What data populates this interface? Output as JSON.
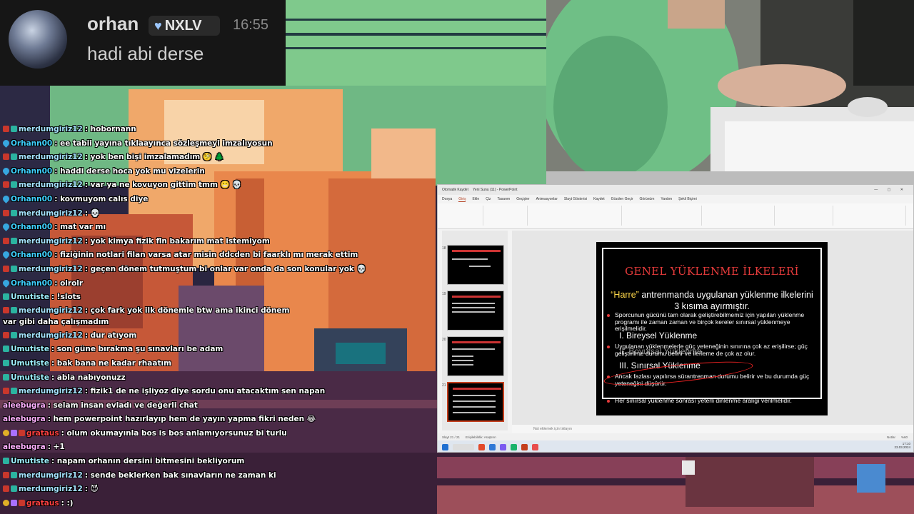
{
  "highlight": {
    "username": "orhan",
    "badge_text": "NXLV",
    "time": "16:55",
    "message": "hadi abi derse"
  },
  "chat": [
    {
      "badges": [
        "mod",
        "gift"
      ],
      "user": "merdumgiriz12",
      "color": "#a6e3ff",
      "text": ": hobornann"
    },
    {
      "badges": [
        "drop"
      ],
      "user": "Orhann00",
      "color": "#3fd0ff",
      "text": ": ee tabii yayına tıklaayınca sözleşmeyi imzalıyosun"
    },
    {
      "badges": [
        "mod",
        "gift"
      ],
      "user": "merdumgiriz12",
      "color": "#a6e3ff",
      "text": ": yok ben bişi imzalamadım 🧐 🌲"
    },
    {
      "badges": [
        "drop"
      ],
      "user": "Orhann00",
      "color": "#3fd0ff",
      "text": ": haddi derse hoca yok mu vizelerin"
    },
    {
      "badges": [
        "mod",
        "gift"
      ],
      "user": "merdumgiriz12",
      "color": "#a6e3ff",
      "text": ": var ya ne kovuyon gittim tmm 😬 💀"
    },
    {
      "badges": [
        "drop"
      ],
      "user": "Orhann00",
      "color": "#3fd0ff",
      "text": ": kovmuyom calıs diye"
    },
    {
      "badges": [
        "mod",
        "gift"
      ],
      "user": "merdumgiriz12",
      "color": "#a6e3ff",
      "text": ": 💀"
    },
    {
      "badges": [
        "drop"
      ],
      "user": "Orhann00",
      "color": "#3fd0ff",
      "text": ": mat var mı"
    },
    {
      "badges": [
        "mod",
        "gift"
      ],
      "user": "merdumgiriz12",
      "color": "#a6e3ff",
      "text": ": yok kimya fizik fln bakarım mat istemiyom"
    },
    {
      "badges": [
        "drop"
      ],
      "user": "Orhann00",
      "color": "#3fd0ff",
      "text": ": fiziğinin notlari filan varsa atar misin ddcden bi faarklı mı merak ettim"
    },
    {
      "badges": [
        "mod",
        "gift"
      ],
      "user": "merdumgiriz12",
      "color": "#a6e3ff",
      "text": ": geçen dönem tutmuştum bi onlar var onda da son konular yok 💀"
    },
    {
      "badges": [
        "drop"
      ],
      "user": "Orhann00",
      "color": "#3fd0ff",
      "text": ": olrolr"
    },
    {
      "badges": [
        "gift"
      ],
      "user": "Umutiste",
      "color": "#9ef0ff",
      "text": ": !slots"
    },
    {
      "badges": [
        "mod",
        "gift"
      ],
      "user": "merdumgiriz12",
      "color": "#a6e3ff",
      "text": ": çok fark yok ilk dönemle btw ama ikinci dönem var gibi daha çalışmadım",
      "wrap": true
    },
    {
      "badges": [
        "mod",
        "gift"
      ],
      "user": "merdumgiriz12",
      "color": "#a6e3ff",
      "text": ": dur atıyom"
    },
    {
      "badges": [
        "gift"
      ],
      "user": "Umutiste",
      "color": "#9ef0ff",
      "text": ": son güne bırakma şu sınavları be adam"
    },
    {
      "badges": [
        "gift"
      ],
      "user": "Umutiste",
      "color": "#9ef0ff",
      "text": ": bak bana ne kadar rhaatım"
    },
    {
      "badges": [
        "gift"
      ],
      "user": "Umutiste",
      "color": "#9ef0ff",
      "text": ": abla nabıyonuzz"
    },
    {
      "badges": [
        "mod",
        "gift"
      ],
      "user": "merdumgiriz12",
      "color": "#a6e3ff",
      "text": ": fizik1 de ne işliyoz diye sordu onu atacaktım sen napan"
    },
    {
      "badges": [],
      "user": "aleebugra",
      "color": "#ffb0ff",
      "text": ": selam insan evladı ve değerli chat"
    },
    {
      "badges": [],
      "user": "aleebugra",
      "color": "#ffb0ff",
      "text": ": hem powerpoint hazırlayıp hem de yayın yapma fikri neden 😂"
    },
    {
      "badges": [
        "sub",
        "prime",
        "mod"
      ],
      "user": "grataus",
      "color": "#ff4040",
      "text": ": olum okumayınla bos is bos anlamıyorsunuz bi turlu"
    },
    {
      "badges": [],
      "user": "aleebugra",
      "color": "#ffb0ff",
      "text": ": +1"
    },
    {
      "badges": [
        "gift"
      ],
      "user": "Umutiste",
      "color": "#9ef0ff",
      "text": ": napam orhanın dersini bitmesini bekliyorum"
    },
    {
      "badges": [
        "mod",
        "gift"
      ],
      "user": "merdumgiriz12",
      "color": "#a6e3ff",
      "text": ": sende beklerken bak sınavların ne zaman ki"
    },
    {
      "badges": [
        "mod",
        "gift"
      ],
      "user": "merdumgiriz12",
      "color": "#a6e3ff",
      "text": ": 😈"
    },
    {
      "badges": [
        "sub",
        "prime",
        "mod"
      ],
      "user": "grataus",
      "color": "#ff4040",
      "text": ": :)"
    }
  ],
  "ppt": {
    "window_title": "Yeni Sunu (11) - PowerPoint",
    "autosave": "Otomatik Kaydet",
    "tabs": [
      "Dosya",
      "Giriş",
      "Ekle",
      "Çiz",
      "Tasarım",
      "Geçişler",
      "Animasyonlar",
      "Slayt Gösterisi",
      "Kaydet",
      "Gözden Geçir",
      "Görünüm",
      "Yardım",
      "Şekil Biçimi"
    ],
    "active_tab": "Giriş",
    "thumb_numbers": [
      "18",
      "19",
      "20",
      "21"
    ],
    "notes_placeholder": "Not eklemek için tıklayın",
    "status_left": "Slayt 21 / 21",
    "status_access": "Erişilebilirlik: Araştırın",
    "status_notes": "Notlar",
    "zoom": "%60",
    "clock_time": "17:10",
    "clock_date": "23.03.2024"
  },
  "slide": {
    "title": "GENEL YÜKLENME İLKELERİ",
    "intro_quote": "“Harre”",
    "intro_rest": " antrenmanda uygulanan yüklenme ilkelerini 3 kısıma ayırmıştır.",
    "bullet1": "Sporcunun gücünü tam olarak geliştirebilmemiz için yapılan yüklenme programı ile zaman zaman ve birçok kereler sınırsal yüklenmeye erişilmelidir.",
    "item1": "I. Bireysel Yüklenme",
    "bullet3": "Uygulanan yüklenmelerle güç yeteneğinin sınırına çok az erişilirse; güç geliştirilme durumu belirir ve ilerleme de çok az olur.",
    "item2": "II. Boyutsal Yüklenme",
    "item3": "III. Sınırsal Yüklenme",
    "bullet4": "Ancak fazlası yapılırsa sürantrenman durumu belirir ve bu durumda güç yeteneğini düşürür.",
    "bullet5": "Her sınırsal yüklenme sonrası yeterli dinlenme aralığı verilmelidir."
  }
}
